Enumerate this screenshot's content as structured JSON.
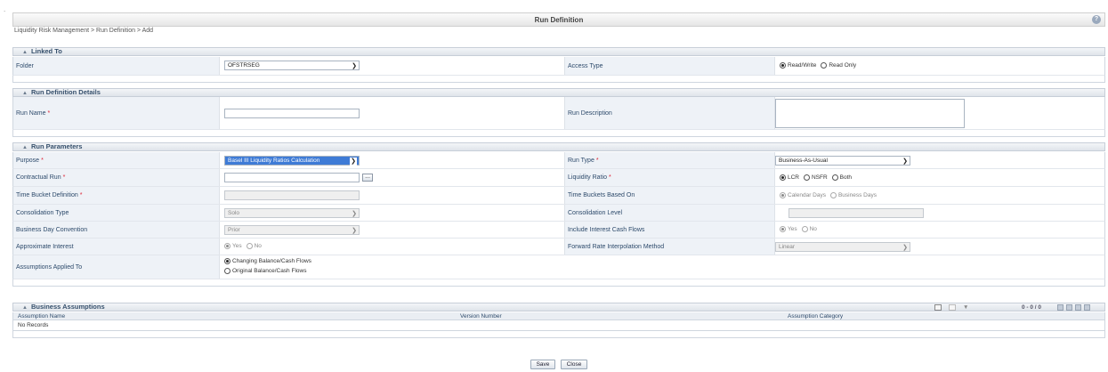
{
  "window": {
    "title": "Run Definition",
    "help_icon": "?"
  },
  "breadcrumb": "Liquidity Risk Management > Run Definition > Add",
  "linked_to": {
    "header": "Linked To",
    "folder_label": "Folder",
    "folder_value": "OFSTRSEG",
    "access_type_label": "Access Type",
    "access_options": [
      "Read/Write",
      "Read Only"
    ],
    "access_selected": "Read/Write"
  },
  "run_definition_details": {
    "header": "Run Definition Details",
    "run_name_label": "Run Name",
    "run_name_value": "",
    "run_description_label": "Run Description",
    "run_description_value": ""
  },
  "run_parameters": {
    "header": "Run Parameters",
    "purpose_label": "Purpose",
    "purpose_value": "Basel III Liquidity Ratios Calculation",
    "run_type_label": "Run Type",
    "run_type_value": "Business-As-Usual",
    "contractual_run_label": "Contractual Run",
    "contractual_run_value": "",
    "contractual_run_browse": "...",
    "liquidity_ratio_label": "Liquidity Ratio",
    "liquidity_ratio_options": [
      "LCR",
      "NSFR",
      "Both"
    ],
    "liquidity_ratio_selected": "LCR",
    "time_bucket_label": "Time Bucket Definition",
    "time_bucket_value": "",
    "time_buckets_based_on_label": "Time Buckets Based On",
    "time_buckets_options": [
      "Calendar Days",
      "Business Days"
    ],
    "consolidation_type_label": "Consolidation Type",
    "consolidation_type_value": "Solo",
    "consolidation_level_label": "Consolidation Level",
    "consolidation_level_value": "",
    "business_day_label": "Business Day Convention",
    "business_day_value": "Prior",
    "include_interest_label": "Include Interest Cash Flows",
    "include_interest_options": [
      "Yes",
      "No"
    ],
    "approx_interest_label": "Approximate Interest",
    "approx_interest_options": [
      "Yes",
      "No"
    ],
    "forward_rate_label": "Forward Rate Interpolation Method",
    "forward_rate_value": "Linear",
    "assumptions_label": "Assumptions Applied To",
    "assumptions_options": [
      "Changing Balance/Cash Flows",
      "Original Balance/Cash Flows"
    ]
  },
  "business_assumptions": {
    "header": "Business Assumptions",
    "pager_text": "0 - 0 / 0",
    "columns": [
      "Assumption Name",
      "Version Number",
      "Assumption Category"
    ],
    "empty_text": "No Records"
  },
  "buttons": {
    "save": "Save",
    "close": "Close"
  }
}
